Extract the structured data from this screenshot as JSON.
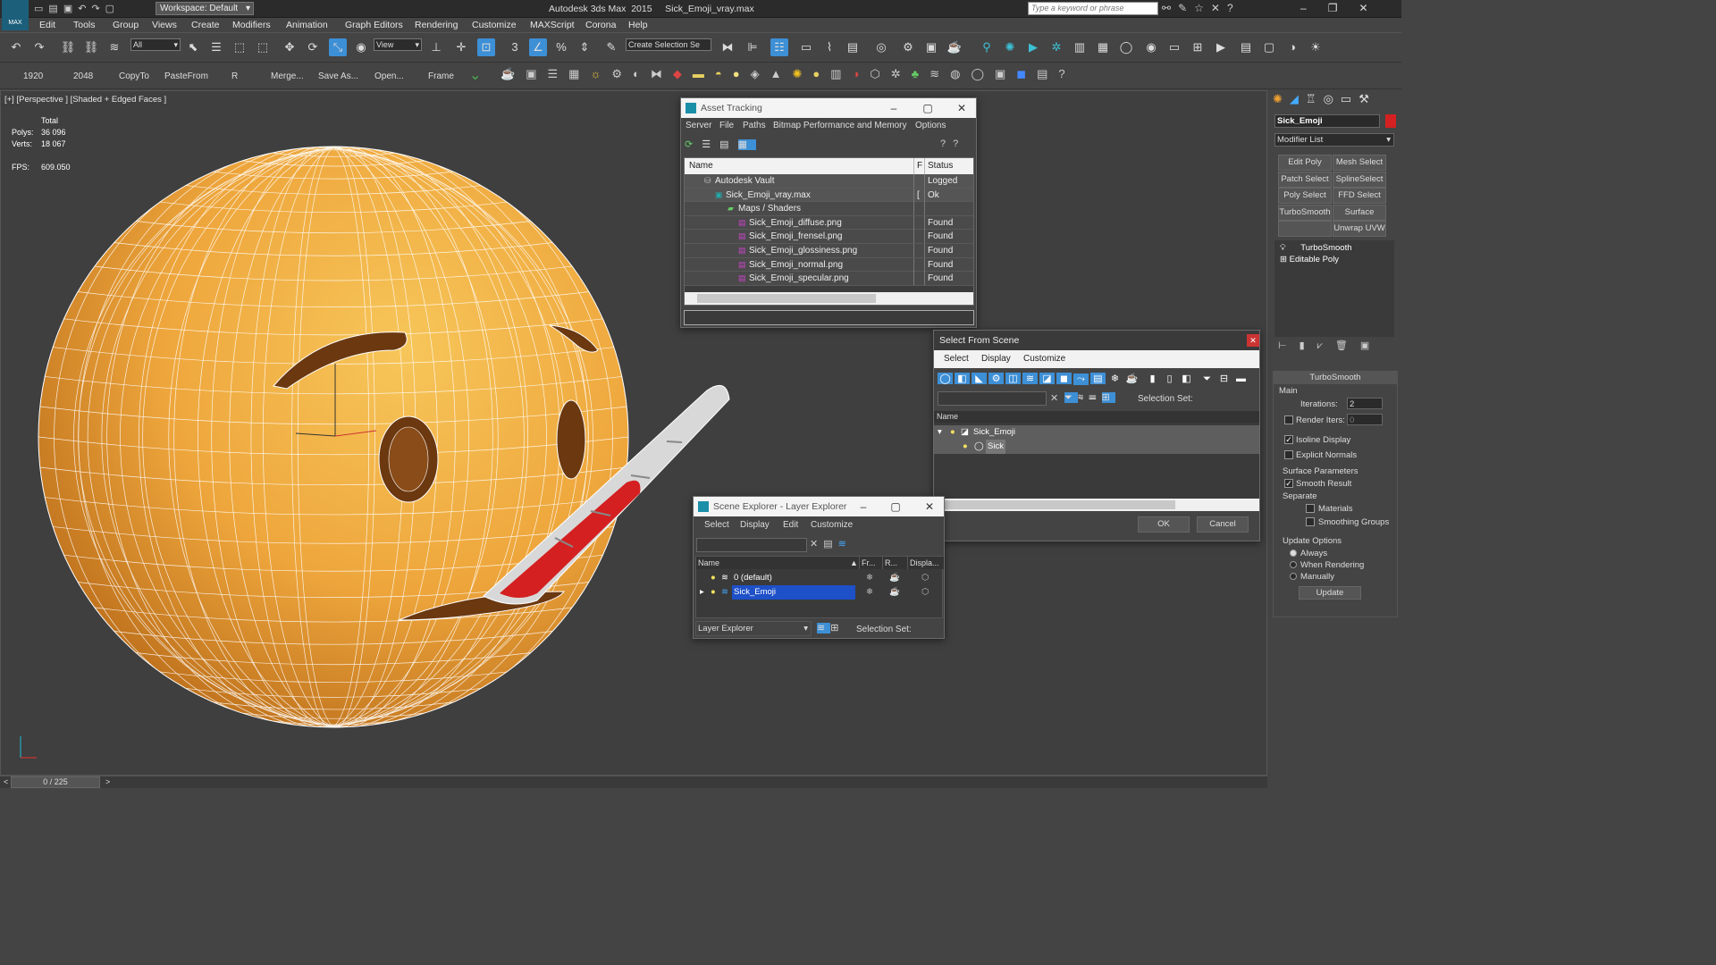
{
  "app": {
    "title": "Autodesk 3ds Max  2015     Sick_Emoji_vray.max",
    "workspace": "Workspace: Default",
    "search_placeholder": "Type a keyword or phrase",
    "logo": "MAX"
  },
  "menu": [
    "Edit",
    "Tools",
    "Group",
    "Views",
    "Create",
    "Modifiers",
    "Animation",
    "Graph Editors",
    "Rendering",
    "Customize",
    "MAXScript",
    "Corona",
    "Help"
  ],
  "toolbar": {
    "selection_filter": "All",
    "ref_coord": "View",
    "named_selection": "Create Selection Se",
    "snap_label": "3",
    "percent_label": "%"
  },
  "toolbar2": {
    "items": [
      "1920",
      "2048",
      "CopyTo",
      "PasteFrom",
      "R",
      "Merge...",
      "Save As...",
      "Open...",
      "Frame"
    ]
  },
  "viewport": {
    "label": "[+] [Perspective ] [Shaded + Edged Faces ]",
    "stats": {
      "total_label": "Total",
      "polys_label": "Polys:",
      "polys_value": "36 096",
      "verts_label": "Verts:",
      "verts_value": "18 067",
      "fps_label": "FPS:",
      "fps_value": "609.050"
    }
  },
  "statusbar": {
    "frame": "0 / 225"
  },
  "asset_tracking": {
    "title": "Asset Tracking",
    "menu": [
      "Server",
      "File",
      "Paths",
      "Bitmap Performance and Memory",
      "Options"
    ],
    "columns": [
      "Name",
      "F",
      "Status"
    ],
    "rows": [
      {
        "name": "Autodesk Vault",
        "f": "",
        "status": "Logged Out"
      },
      {
        "name": "Sick_Emoji_vray.max",
        "f": "[",
        "status": "Ok"
      },
      {
        "name": "Maps / Shaders",
        "f": "",
        "status": ""
      },
      {
        "name": "Sick_Emoji_diffuse.png",
        "f": "",
        "status": "Found"
      },
      {
        "name": "Sick_Emoji_frensel.png",
        "f": "",
        "status": "Found"
      },
      {
        "name": "Sick_Emoji_glossiness.png",
        "f": "",
        "status": "Found"
      },
      {
        "name": "Sick_Emoji_normal.png",
        "f": "",
        "status": "Found"
      },
      {
        "name": "Sick_Emoji_specular.png",
        "f": "",
        "status": "Found"
      }
    ]
  },
  "select_from_scene": {
    "title": "Select From Scene",
    "menu": [
      "Select",
      "Display",
      "Customize"
    ],
    "selection_set_label": "Selection Set:",
    "column": "Name",
    "items": [
      "Sick_Emoji",
      "Sick"
    ],
    "ok": "OK",
    "cancel": "Cancel"
  },
  "layer_explorer": {
    "title": "Scene Explorer - Layer Explorer",
    "menu": [
      "Select",
      "Display",
      "Edit",
      "Customize"
    ],
    "columns": [
      "Name",
      "Fr...",
      "R...",
      "Displa..."
    ],
    "rows": [
      "0 (default)",
      "Sick_Emoji"
    ],
    "footer_dropdown": "Layer Explorer",
    "selection_set_label": "Selection Set:"
  },
  "command_panel": {
    "object_name": "Sick_Emoji",
    "modifier_list": "Modifier List",
    "buttons": [
      "Edit Poly",
      "Mesh Select",
      "Patch Select",
      "SplineSelect",
      "Poly Select",
      "FFD Select",
      "TurboSmooth",
      "Surface Select",
      "Unwrap UVW"
    ],
    "stack": [
      "TurboSmooth",
      "Editable Poly"
    ],
    "rollout_title": "TurboSmooth",
    "main_label": "Main",
    "iterations_label": "Iterations:",
    "iterations_value": "2",
    "render_iters_label": "Render Iters:",
    "render_iters_value": "0",
    "isoline_label": "Isoline Display",
    "explicit_normals_label": "Explicit Normals",
    "surface_params_label": "Surface Parameters",
    "smooth_result_label": "Smooth Result",
    "separate_label": "Separate",
    "materials_label": "Materials",
    "smoothing_groups_label": "Smoothing Groups",
    "update_options_label": "Update Options",
    "always_label": "Always",
    "when_rendering_label": "When Rendering",
    "manually_label": "Manually",
    "update_button": "Update"
  },
  "colors": {
    "accent": "#3d8fd6",
    "emoji": "#f0b048",
    "thermometer_red": "#d42020",
    "selection": "#1e50c8"
  }
}
